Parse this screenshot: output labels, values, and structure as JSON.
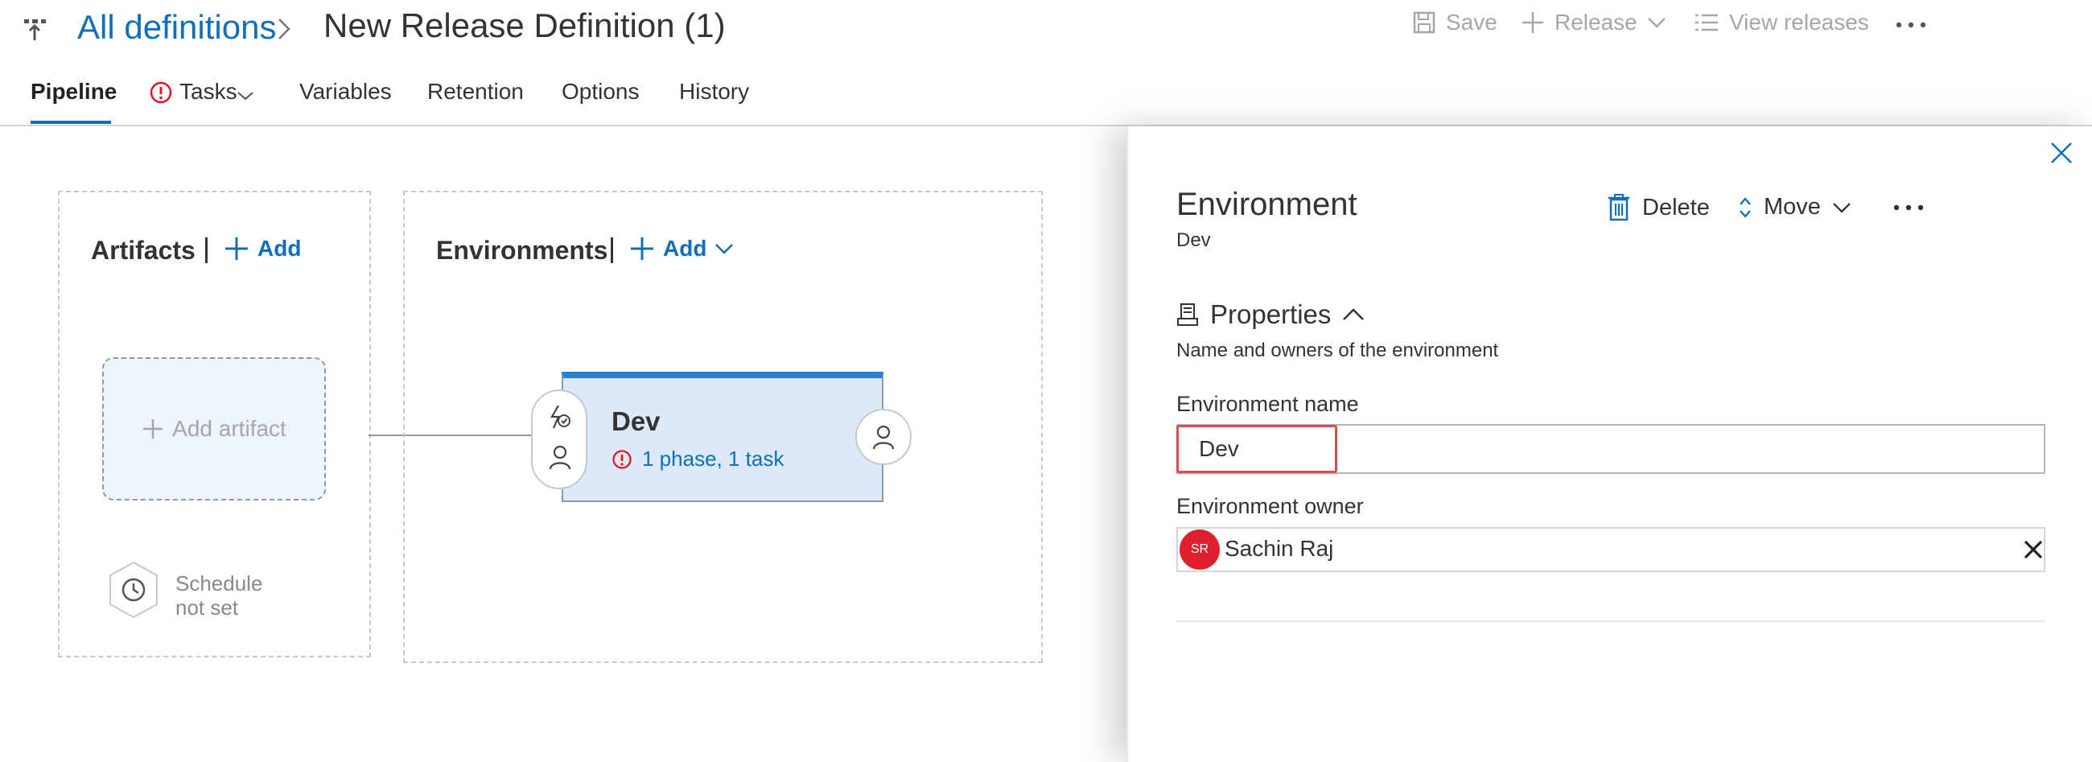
{
  "header": {
    "breadcrumb": "All definitions",
    "title": "New Release Definition (1)",
    "commands": {
      "save": "Save",
      "release": "Release",
      "view_releases": "View releases"
    }
  },
  "tabs": [
    {
      "label": "Pipeline",
      "active": true
    },
    {
      "label": "Tasks",
      "has_error": true
    },
    {
      "label": "Variables"
    },
    {
      "label": "Retention"
    },
    {
      "label": "Options"
    },
    {
      "label": "History"
    }
  ],
  "pipeline": {
    "artifacts": {
      "title": "Artifacts",
      "add_label": "Add",
      "add_artifact_label": "Add artifact",
      "schedule_line1": "Schedule",
      "schedule_line2": "not set"
    },
    "environments": {
      "title": "Environments",
      "add_label": "Add",
      "card": {
        "name": "Dev",
        "status": "1 phase, 1 task"
      }
    }
  },
  "panel": {
    "title": "Environment",
    "subtitle": "Dev",
    "delete_label": "Delete",
    "move_label": "Move",
    "properties": {
      "title": "Properties",
      "description": "Name and owners of the environment"
    },
    "env_name_label": "Environment name",
    "env_name_value": "Dev",
    "env_owner_label": "Environment owner",
    "owner": {
      "initials": "SR",
      "name": "Sachin Raj"
    }
  },
  "colors": {
    "accent": "#106ebe",
    "error": "#e81123",
    "highlight": "#e04b4b",
    "env_card_bg": "#dce9f6",
    "avatar_bg": "#e0212d"
  }
}
